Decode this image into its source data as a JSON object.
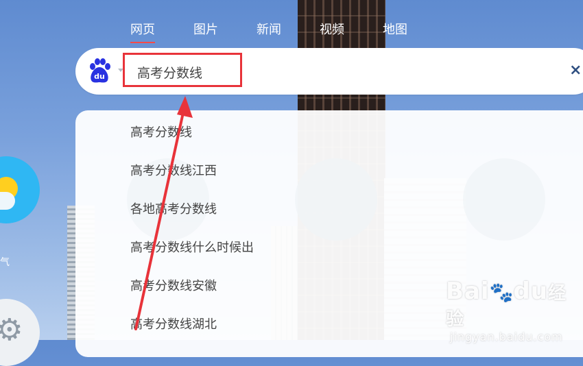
{
  "tabs": [
    {
      "label": "网页",
      "active": true
    },
    {
      "label": "图片",
      "active": false
    },
    {
      "label": "新闻",
      "active": false
    },
    {
      "label": "视频",
      "active": false
    },
    {
      "label": "地图",
      "active": false
    }
  ],
  "search": {
    "value": "高考分数线",
    "clear_symbol": "×",
    "logo_text": "du"
  },
  "suggestions": [
    "高考分数线",
    "高考分数线江西",
    "各地高考分数线",
    "高考分数线什么时候出",
    "高考分数线安徽",
    "高考分数线湖北"
  ],
  "sidebar": {
    "weather_label": "气"
  },
  "watermark": {
    "brand_left": "Bai",
    "brand_right": "du",
    "brand_cn": "经验",
    "domain": "jingyan.baidu.com"
  },
  "colors": {
    "accent_red": "#e8333a",
    "active_tab_underline": "#ff4a48",
    "baidu_blue": "#2932e1",
    "clear_icon": "#2e4f80"
  },
  "icons": {
    "logo": "baidu-paw-icon",
    "clear": "close-icon",
    "weather": "sun-cloud-icon",
    "settings": "gear-icon"
  }
}
